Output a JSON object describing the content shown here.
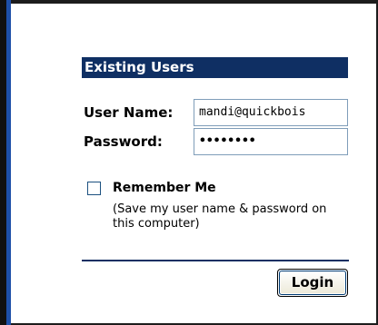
{
  "login_form": {
    "header": "Existing Users",
    "username": {
      "label": "User Name:",
      "value": "mandi@quickbois"
    },
    "password": {
      "label": "Password:",
      "masked_value": "••••••••"
    },
    "remember": {
      "label": "Remember Me",
      "checked": false,
      "note": "(Save my user name & password on this computer)"
    },
    "login_button": "Login"
  },
  "colors": {
    "header_bg": "#0f2f63",
    "left_accent": "#1d4fa8",
    "input_border": "#7f9db9"
  }
}
